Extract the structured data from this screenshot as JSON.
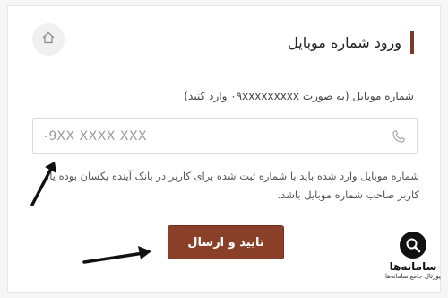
{
  "header": {
    "title": "ورود شماره موبایل",
    "home_icon": "home-icon"
  },
  "form": {
    "label": "شماره موبایل (به صورت ۰۹xxxxxxxxx وارد کنید)",
    "placeholder": "۰9XX XXXX XXX",
    "phone_icon": "phone-icon",
    "help_text": "شماره موبایل وارد شده باید با شماره ثبت شده برای کاربر در بانک آینده یکسان بوده یا، کاربر صاحب شماره موبایل باشد.",
    "submit_label": "تایید و ارسال"
  },
  "watermark": {
    "name": "سامانه‌ها",
    "tagline": "پورتال جامع سامانه‌ها"
  },
  "colors": {
    "accent": "#8a3f28",
    "title_bar": "#7a3a2a"
  }
}
